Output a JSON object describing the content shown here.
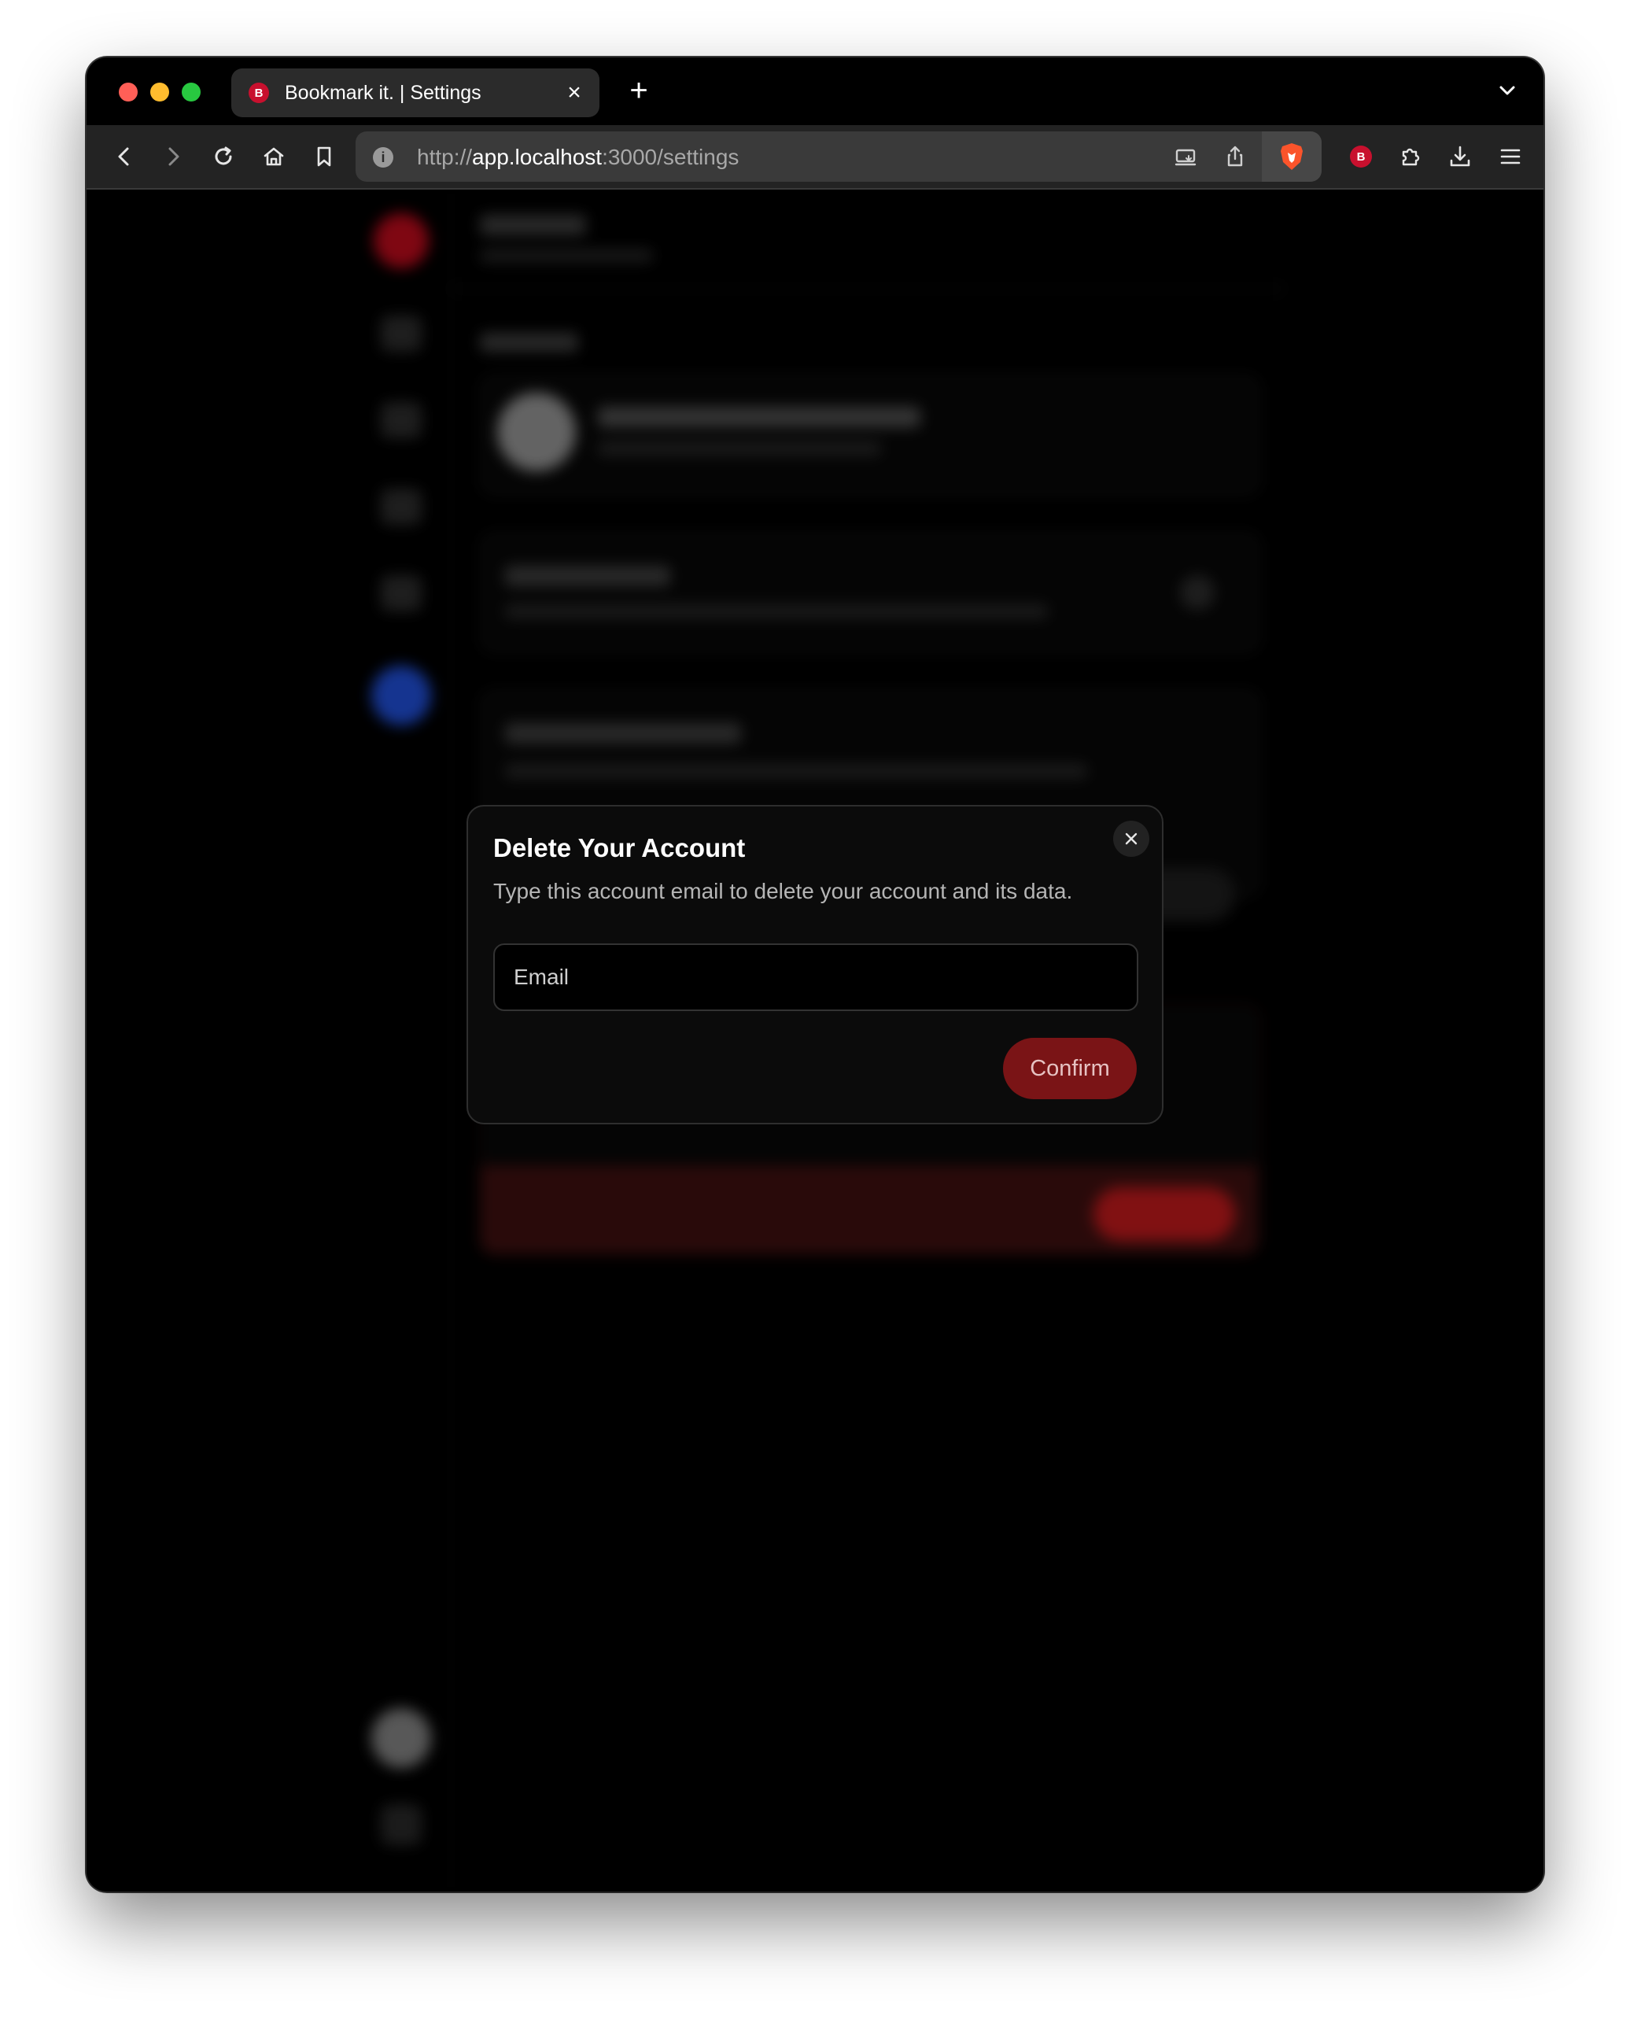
{
  "browser": {
    "tab": {
      "title": "Bookmark it. | Settings",
      "favicon": "bookmark-it-logo",
      "close_icon": "close-icon"
    },
    "new_tab_icon": "plus-icon",
    "tab_list_icon": "chevron-down-icon",
    "address": {
      "scheme": "http://",
      "host": "app.localhost",
      "rest": ":3000/settings",
      "info_icon": "info-icon"
    },
    "toolbar_icons": [
      "back-icon",
      "forward-icon",
      "reload-icon",
      "home-icon",
      "bookmark-icon",
      "cast-icon",
      "share-icon",
      "brave-shields-icon",
      "extension-bookmark-it-icon",
      "extensions-icon",
      "download-icon",
      "menu-icon"
    ]
  },
  "modal": {
    "title": "Delete Your Account",
    "description": "Type this account email to delete your account and its data.",
    "email_placeholder": "Email",
    "email_value": "",
    "confirm_label": "Confirm",
    "close_icon": "close-icon"
  },
  "colors": {
    "danger": "#7a1416",
    "accent_blue": "#1e49c8",
    "brand_red": "#c8102e"
  }
}
